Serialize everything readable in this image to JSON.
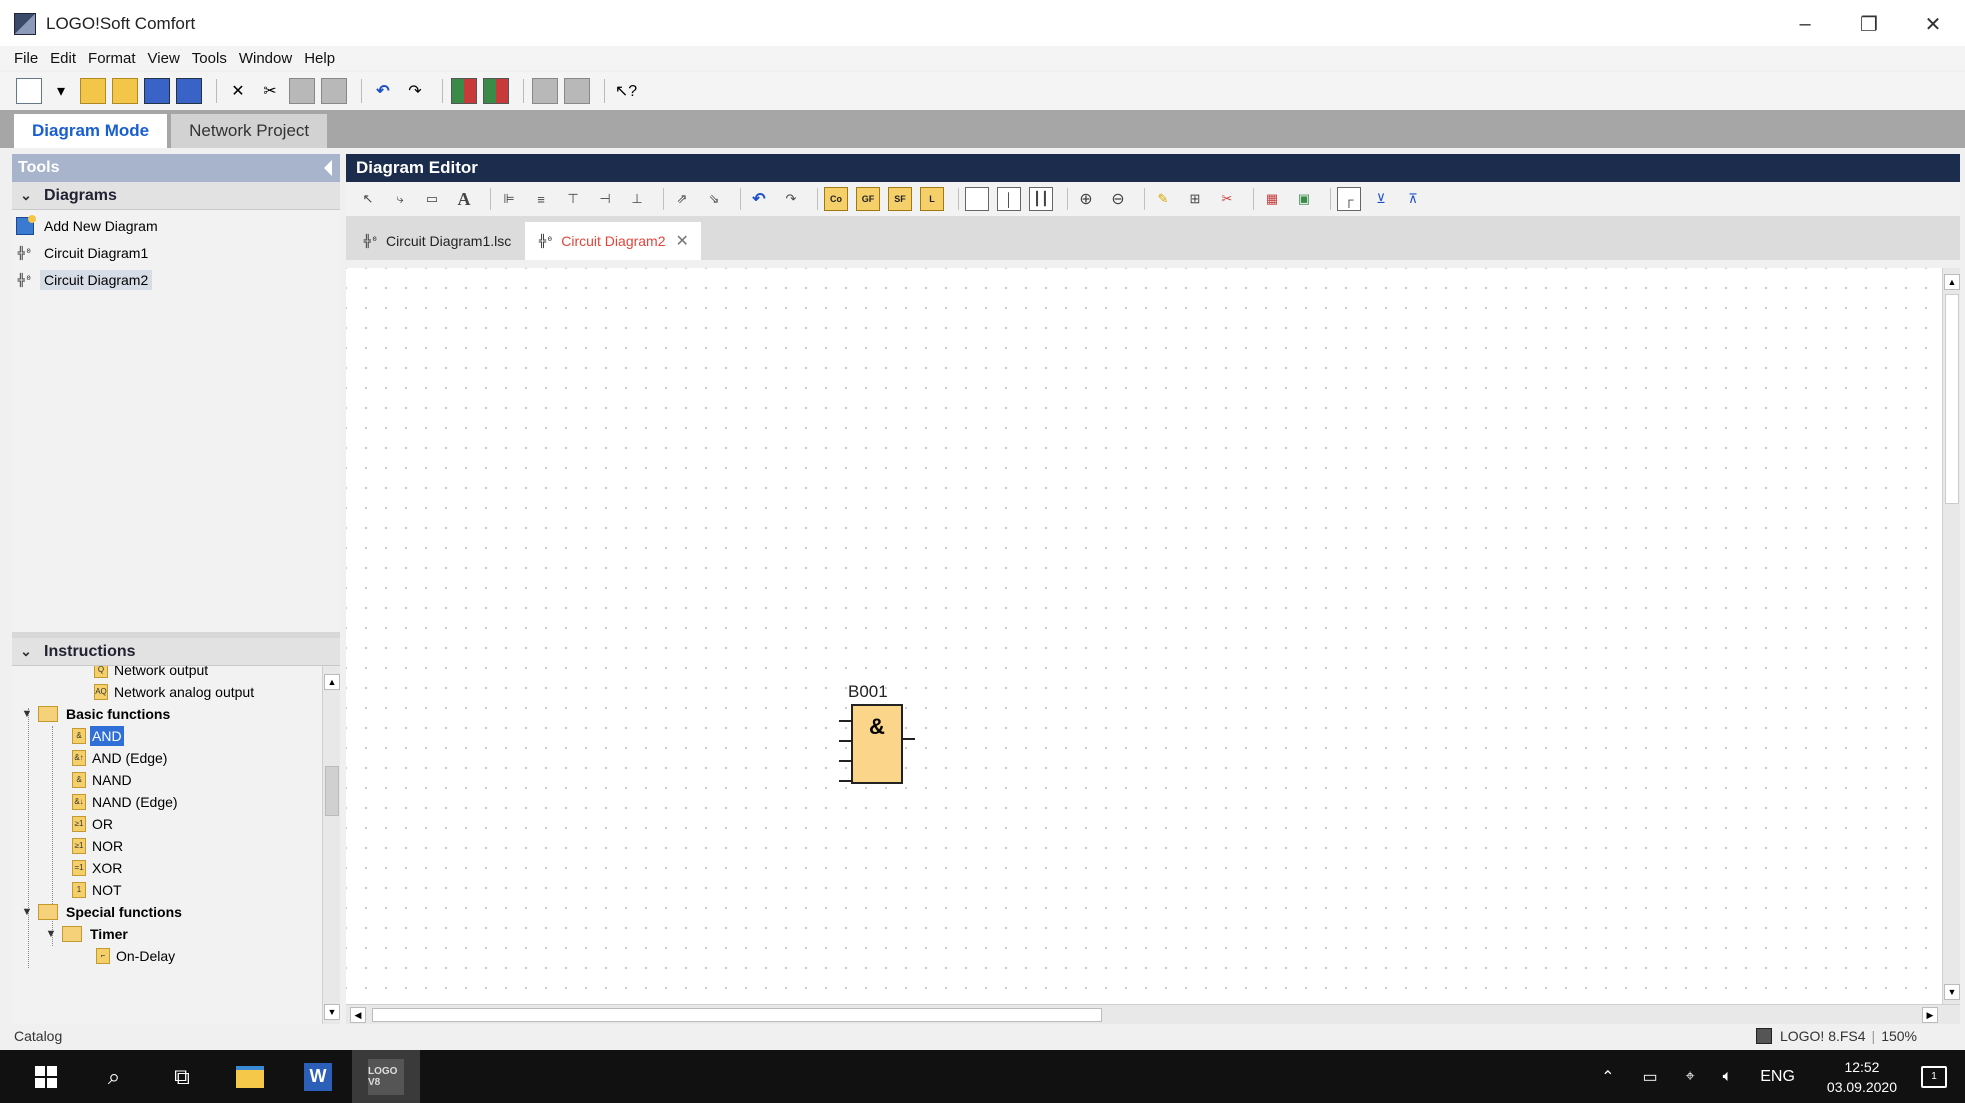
{
  "window": {
    "title": "LOGO!Soft Comfort",
    "minimize": "–",
    "restore": "❐",
    "close": "✕"
  },
  "menu": [
    "File",
    "Edit",
    "Format",
    "View",
    "Tools",
    "Window",
    "Help"
  ],
  "mode_tabs": {
    "diagram_mode": "Diagram Mode",
    "network_project": "Network Project"
  },
  "tools_panel": {
    "title": "Tools",
    "diagrams": {
      "header": "Diagrams",
      "items": [
        "Add New Diagram",
        "Circuit Diagram1",
        "Circuit Diagram2"
      ],
      "selected": "Circuit Diagram2"
    },
    "instructions": {
      "header": "Instructions",
      "partial_item": "Network output",
      "network_analog_output": "Network analog output",
      "basic_functions": "Basic functions",
      "basic_items": [
        "AND",
        "AND (Edge)",
        "NAND",
        "NAND (Edge)",
        "OR",
        "NOR",
        "XOR",
        "NOT"
      ],
      "selected": "AND",
      "special_functions": "Special functions",
      "timer": "Timer",
      "on_delay": "On-Delay"
    }
  },
  "editor": {
    "title": "Diagram Editor",
    "tabs": [
      {
        "label": "Circuit Diagram1.lsc",
        "active": false
      },
      {
        "label": "Circuit Diagram2",
        "active": true
      }
    ],
    "tab_close": "✕",
    "toolbar_labels": {
      "co": "Co",
      "gf": "GF",
      "sf": "SF",
      "l": "L"
    },
    "block": {
      "id": "B001",
      "symbol": "&"
    }
  },
  "status": {
    "left": "Catalog",
    "device": "LOGO! 8.FS4",
    "zoom": "150%"
  },
  "taskbar": {
    "logo_app": "LOGO V8",
    "word_app": "W",
    "language": "ENG",
    "time": "12:52",
    "date": "03.09.2020",
    "notifications": "1"
  },
  "colors": {
    "editor_header": "#1b2c4c",
    "tools_header": "#a8b4cc",
    "active_tab_text": "#e0453a",
    "mode_tab_active_text": "#1a5fd0",
    "selection": "#2f6fd6",
    "block_fill": "#fbd58a"
  }
}
